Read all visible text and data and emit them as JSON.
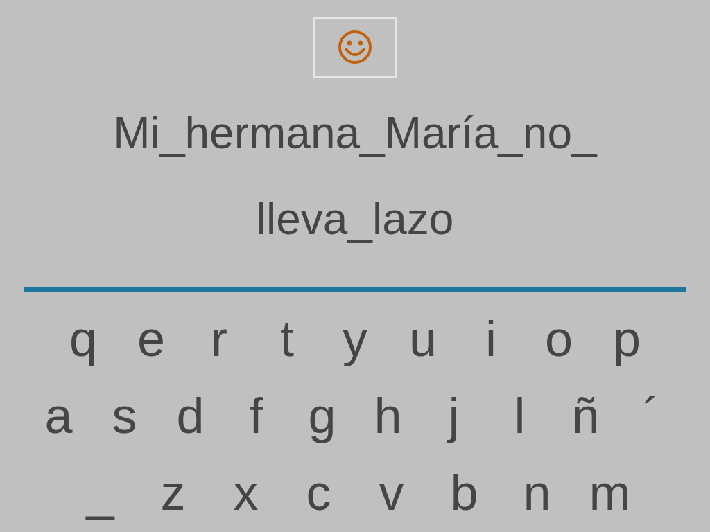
{
  "sentence_lines": [
    "Mi_hermana_María_no_",
    "lleva_lazo"
  ],
  "keyboard_rows": [
    [
      "q",
      "e",
      "r",
      "t",
      "y",
      "u",
      "i",
      "o",
      "p"
    ],
    [
      "a",
      "s",
      "d",
      "f",
      "g",
      "h",
      "j",
      "l",
      "ñ",
      "´"
    ],
    [
      "_",
      "z",
      "x",
      "c",
      "v",
      "b",
      "n",
      "m"
    ]
  ]
}
